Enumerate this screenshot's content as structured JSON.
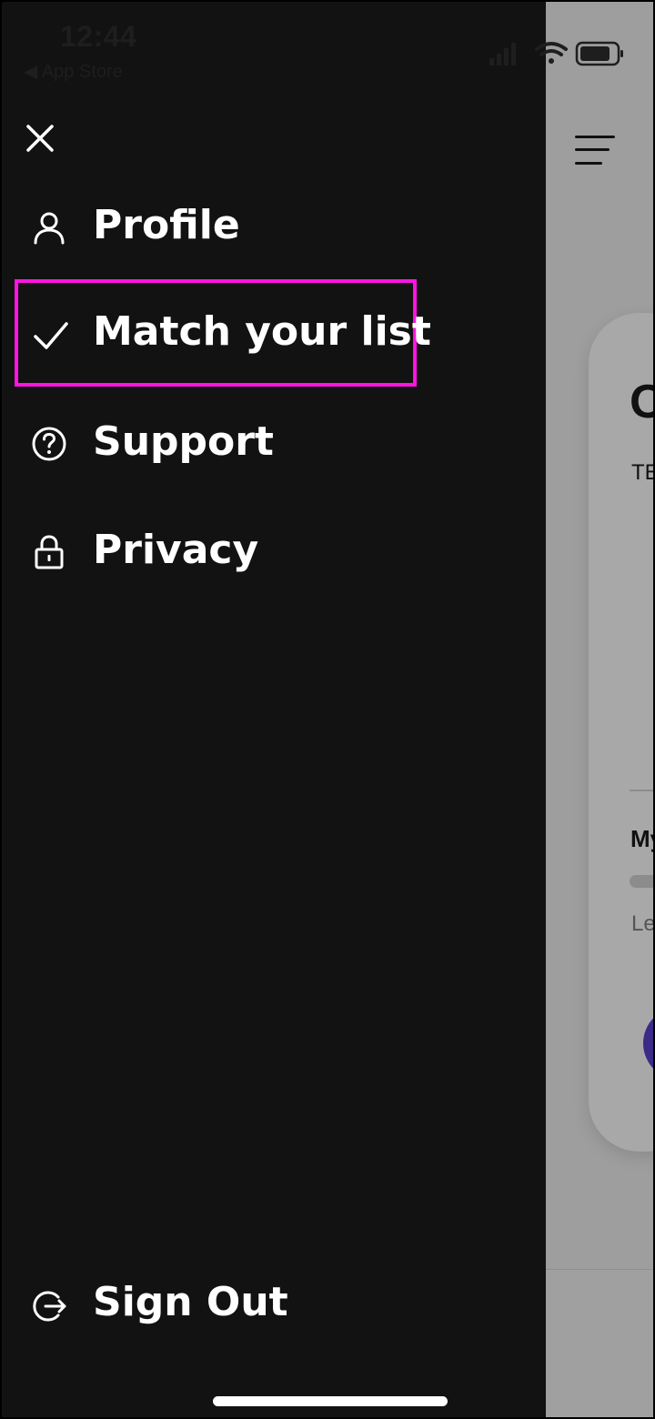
{
  "status_bar": {
    "time": "12:44",
    "back_label": "◀ App Store"
  },
  "drawer": {
    "close_icon": "close-icon",
    "items": [
      {
        "label": "Profile",
        "icon": "user-icon"
      },
      {
        "label": "Match your list",
        "icon": "checkmark-icon",
        "highlighted": true
      },
      {
        "label": "Support",
        "icon": "help-circle-icon"
      },
      {
        "label": "Privacy",
        "icon": "lock-icon"
      }
    ],
    "sign_out": {
      "label": "Sign Out",
      "icon": "sign-out-icon"
    }
  },
  "background": {
    "card_title": "O",
    "card_subtitle": "TE",
    "section_label": "My",
    "progress_caption": "Le"
  },
  "colors": {
    "drawer_bg": "#121212",
    "highlight_border": "#ff14e4",
    "text": "#ffffff",
    "overlay_bg": "#9e9e9e"
  }
}
